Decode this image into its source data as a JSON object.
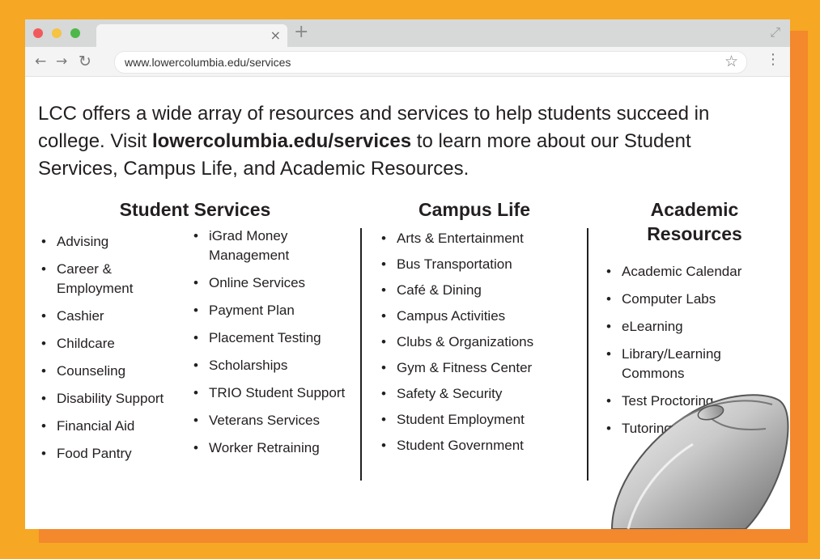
{
  "browser": {
    "url": "www.lowercolumbia.edu/services",
    "tab_close": "×",
    "new_tab": "+",
    "expand_icon": "⤢",
    "nav_back": "←",
    "nav_forward": "→",
    "nav_reload": "↻",
    "star_icon": "☆",
    "menu_icon": "⋮"
  },
  "intro": {
    "before": "LCC offers a wide array of resources and services to help students succeed in college. Visit ",
    "link": "lowercolumbia.edu/services",
    "after": " to learn more about our Student Services, Campus Life, and Academic Resources."
  },
  "student_services": {
    "title": "Student Services",
    "left": [
      "Advising",
      "Career & Employment",
      "Cashier",
      "Childcare",
      "Counseling",
      "Disability Support",
      "Financial Aid",
      "Food Pantry"
    ],
    "right": [
      "iGrad Money Management",
      "Online Services",
      "Payment Plan",
      "Placement Testing",
      "Scholarships",
      "TRIO Student Support",
      "Veterans Services",
      "Worker Retraining"
    ]
  },
  "campus_life": {
    "title": "Campus Life",
    "items": [
      "Arts & Entertainment",
      "Bus Transportation",
      "Café & Dining",
      "Campus Activities",
      "Clubs & Organizations",
      "Gym & Fitness Center",
      "Safety & Security",
      "Student Employment",
      "Student Government"
    ]
  },
  "academic_resources": {
    "title": "Academic Resources",
    "items": [
      "Academic Calendar",
      "Computer Labs",
      "eLearning",
      "Library/Learning Commons",
      "Test Proctoring",
      "Tutoring"
    ]
  },
  "colors": {
    "background": "#f6a723",
    "shadow": "#f3882c",
    "text": "#231f20",
    "tabbar": "#d7d8d8"
  }
}
